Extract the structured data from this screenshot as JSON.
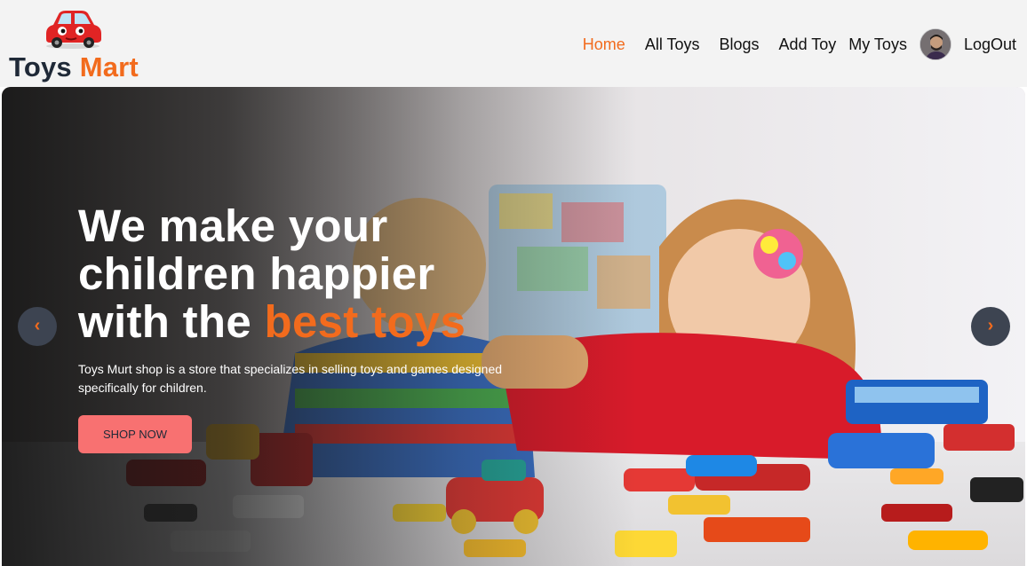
{
  "brand": {
    "name_part1": "Toys",
    "name_part2": "Mart",
    "accent_color": "#f26b1d"
  },
  "nav": {
    "items": [
      {
        "label": "Home",
        "active": true
      },
      {
        "label": "All Toys"
      },
      {
        "label": "Blogs"
      },
      {
        "label": "Add Toy"
      },
      {
        "label": "My Toys"
      }
    ],
    "logout_label": "LogOut"
  },
  "hero": {
    "title_line1": "We make your",
    "title_line2": "children happier",
    "title_line3_prefix": "with the",
    "title_line3_accent": "best toys",
    "description": "Toys Murt shop is a store that specializes in selling toys and games designed specifically for children.",
    "cta_label": "SHOP NOW",
    "cta_color": "#f87171",
    "prev_arrow": "‹",
    "next_arrow": "›"
  }
}
